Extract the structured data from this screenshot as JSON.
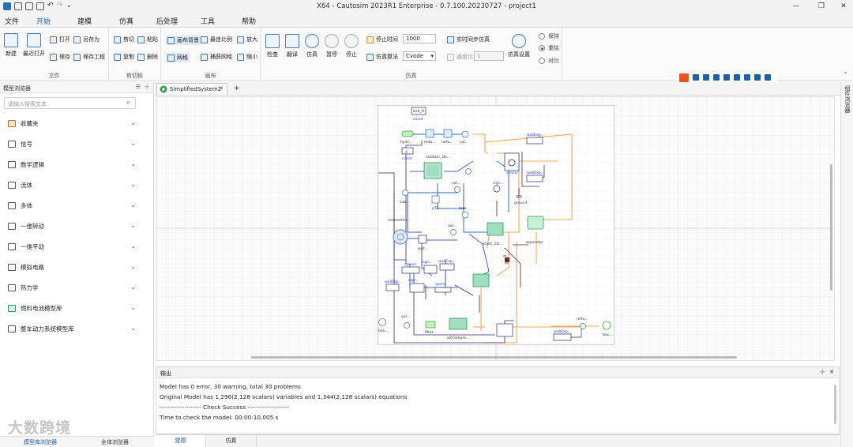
{
  "window": {
    "title": "X64 - Cautosim 2023R1 Enterprise - 0.7.100.20230727 - project1"
  },
  "menu": {
    "items": [
      "文件",
      "开始",
      "建模",
      "仿真",
      "后处理",
      "工具",
      "帮助"
    ],
    "active": "开始"
  },
  "ribbon": {
    "file": {
      "label": "文件",
      "new": "新建",
      "recent": "最近打开",
      "open": "打开",
      "save_as": "另存为",
      "save": "保存",
      "save_project": "保存工程"
    },
    "clipboard": {
      "label": "剪切板",
      "cut": "剪切",
      "paste": "粘贴",
      "copy": "复制",
      "delete": "删除"
    },
    "canvas": {
      "label": "画布",
      "background": "画布背景",
      "best_fit": "最佳比例",
      "zoom_in": "放大",
      "grid": "网格",
      "snap_grid": "捕获网格",
      "zoom_out": "缩小"
    },
    "simulation": {
      "label": "仿真",
      "check": "检查",
      "translate": "翻译",
      "simulate": "仿真",
      "pause": "暂停",
      "stop": "停止",
      "stop_time_label": "停止时间",
      "stop_time_value": "1000",
      "algorithm_label": "仿真算法",
      "algorithm_value": "Cvode",
      "realtime": "实时同步仿真",
      "speed_ratio_label": "速度比",
      "speed_ratio_value": "1",
      "settings": "仿真设置"
    },
    "options": {
      "keep": "保持",
      "overlay": "重绘",
      "compare": "对比",
      "selected": "重绘"
    }
  },
  "left_panel": {
    "title": "模型浏览器",
    "search_placeholder": "请输入搜索文本",
    "items": [
      {
        "label": "收藏夹",
        "icon": "folder-icon"
      },
      {
        "label": "信号",
        "icon": "signal-icon"
      },
      {
        "label": "数学逻辑",
        "icon": "math-icon"
      },
      {
        "label": "流体",
        "icon": "fluid-icon"
      },
      {
        "label": "多体",
        "icon": "multibody-icon"
      },
      {
        "label": "一维转动",
        "icon": "rotation-icon"
      },
      {
        "label": "一维平动",
        "icon": "translation-icon"
      },
      {
        "label": "模拟电路",
        "icon": "circuit-icon"
      },
      {
        "label": "热力学",
        "icon": "thermo-icon"
      },
      {
        "label": "燃料电池模型库",
        "icon": "fuelcell-icon"
      },
      {
        "label": "整车动力系统模型库",
        "icon": "vehicle-icon"
      }
    ],
    "bottom_tabs": [
      "模型库浏览器",
      "全体浏览器"
    ]
  },
  "document": {
    "tab_label": "SimplifiedSystem2",
    "add": "+"
  },
  "diagram": {
    "labels": {
      "knk": "knk_H",
      "const1": "const",
      "hydr": "hydr...",
      "redu1": "redu...",
      "redu2": "redu...",
      "vol1": "vol...",
      "const2_val": "4",
      "const2": "const",
      "radiator": "radiator_De...",
      "sensor": "sensor",
      "ground": "ground",
      "wallexp1": "wallExp...",
      "wallexp2": "wallExp...",
      "sub": "sub...",
      "vol2": "vol...",
      "sign": "sign...",
      "ptc": "pTC",
      "tem": "tem...",
      "volumetric": "volumetric...",
      "vol3": "vol...",
      "wat": "wat...",
      "stack": "stack_1D...",
      "seperator": "seperator",
      "speed1": "speed",
      "sign2": "sign...",
      "wallexp3": "wallExp...",
      "wallexp4": "wallExp...",
      "sign3": "sign...",
      "speed2": "speed",
      "bou1": "bou...",
      "vol4": "vol...",
      "filter": "filter",
      "aircomp": "airCompre...",
      "wallexp5": "wallExp...",
      "redu3": "redu...",
      "bou2": "bou...",
      "radiator_v": "radiator_De...",
      "humidifier": "hum...",
      "pt": "pt"
    }
  },
  "output": {
    "title": "输出",
    "lines": [
      "Model has 0 error, 30 warning, total 30 problems",
      "Original Model has 1,296(2,128 scalars) variables and 1,344(2,128 scalars) equations",
      "-------------------- Check Success --------------------",
      "Time to check the model: 00:00:10.005 s"
    ]
  },
  "bottom_tabs": [
    "建模",
    "仿真"
  ],
  "right_dock": {
    "label": "组件浏览器"
  },
  "watermark": "大数跨境",
  "colors": {
    "accent": "#1f5fa9",
    "pipe_orange": "#f2a85b",
    "pipe_blue": "#3c67b8",
    "signal_navy": "#2b2b6f",
    "component_green": "#3fb37a"
  }
}
